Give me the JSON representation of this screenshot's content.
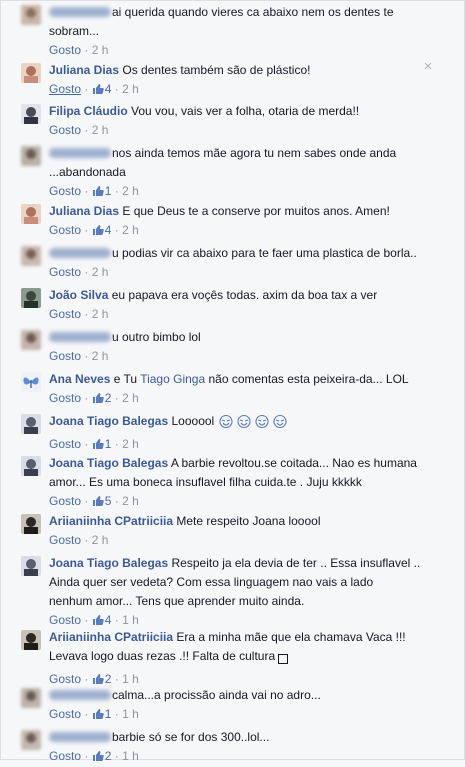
{
  "comments": [
    {
      "author": "",
      "blurred": true,
      "text": "ai querida quando vieres ca abaixo nem os dentes te",
      "text2": "sobram...",
      "like": "Gosto",
      "likes": "",
      "time": "2 h"
    },
    {
      "author": "Juliana Dias",
      "blurred": false,
      "text": "Os dentes também são de plástico!",
      "like": "Gosto",
      "likes": "4",
      "time": "2 h"
    },
    {
      "author": "Filipa Cláudio",
      "blurred": false,
      "text": "Vou vou, vais ver a folha, otaria de merda!!",
      "like": "Gosto",
      "likes": "",
      "time": "2 h"
    },
    {
      "author": "",
      "blurred": true,
      "text": "nos ainda temos mãe agora tu nem sabes onde anda",
      "text2": "...abandonada",
      "like": "Gosto",
      "likes": "1",
      "time": "2 h"
    },
    {
      "author": "Juliana Dias",
      "blurred": false,
      "text": "E que Deus te a conserve por muitos anos. Amen!",
      "like": "Gosto",
      "likes": "4",
      "time": "2 h"
    },
    {
      "author": "",
      "blurred": true,
      "text": "u podias vir ca abaixo para te faer uma plastica de borla..",
      "like": "Gosto",
      "likes": "",
      "time": "2 h"
    },
    {
      "author": "João Silva",
      "blurred": false,
      "text": "eu papava era voçês todas. axim da boa tax a ver",
      "like": "Gosto",
      "likes": "",
      "time": "2 h"
    },
    {
      "author": "",
      "blurred": true,
      "text": "u outro bimbo lol",
      "like": "Gosto",
      "likes": "",
      "time": "2 h"
    },
    {
      "author": "Ana Neves",
      "blurred": false,
      "text_pre": "e Tu",
      "mention": "Tiago Ginga",
      "text": "não comentas esta peixeira-da... LOL",
      "like": "Gosto",
      "likes": "2",
      "time": "2 h"
    },
    {
      "author": "Joana Tiago Balegas",
      "blurred": false,
      "text": "Loooool",
      "like": "Gosto",
      "likes": "1",
      "time": "2 h"
    },
    {
      "author": "Joana Tiago Balegas",
      "blurred": false,
      "text": "A barbie revoltou.se coitada... Nao es humana",
      "text2": "amor... Es uma boneca insuflavel filha cuida.te . Juju kkkkk",
      "like": "Gosto",
      "likes": "5",
      "time": "2 h"
    },
    {
      "author": "Ariianiinha CPatriiciia",
      "blurred": false,
      "text": "Mete respeito Joana looool",
      "like": "Gosto",
      "likes": "",
      "time": "2 h"
    },
    {
      "author": "Joana Tiago Balegas",
      "blurred": false,
      "text": "Respeito ja ela devia de ter .. Essa insuflavel ..",
      "text2": "Ainda quer ser vedeta? Com essa linguagem nao vais a lado",
      "text3": "nenhum amor... Tens que aprender muito ainda.",
      "like": "Gosto",
      "likes": "4",
      "time": "1 h"
    },
    {
      "author": "Ariianiinha CPatriiciia",
      "blurred": false,
      "text": "Era a minha mãe que ela chamava Vaca !!!",
      "text2": "Levava logo duas rezas .!! Falta de cultura",
      "like": "Gosto",
      "likes": "2",
      "time": "1 h"
    },
    {
      "author": "",
      "blurred": true,
      "text": "calma...a procissão ainda vai no adro...",
      "like": "Gosto",
      "likes": "1",
      "time": "1 h"
    },
    {
      "author": "",
      "blurred": true,
      "text": "barbie só se for dos 300..lol...",
      "like": "Gosto",
      "likes": "2",
      "time": "1 h"
    }
  ],
  "sep": "·",
  "close_icon": "×",
  "colors": {
    "link": "#3b5998",
    "meta": "#90949c",
    "background": "#f6f7f9"
  }
}
